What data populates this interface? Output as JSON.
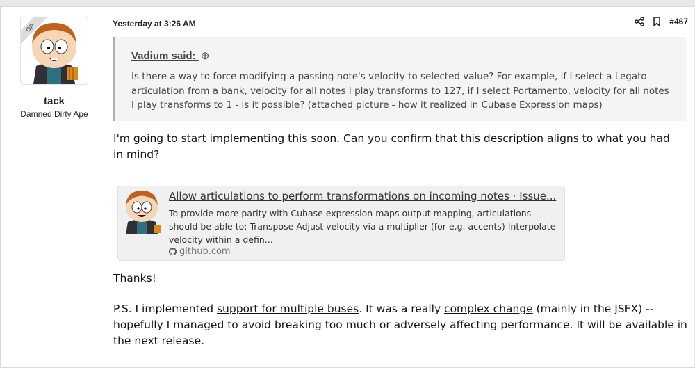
{
  "author": {
    "op_badge": "OP",
    "name": "tack",
    "title": "Damned Dirty Ape"
  },
  "post": {
    "date": "Yesterday at 3:26 AM",
    "number": "#467",
    "quote": {
      "author_line": "Vadium said:",
      "arrow": "⊕",
      "text": "Is there a way to force modifying a passing note's velocity to selected value? For example, if I select a Legato articulation from a bank, velocity for all notes I play transforms to 127, if I select Portamento, velocity for all notes I play transforms to 1 - is it possible? (attached picture - how it realized in Cubase Expression maps)"
    },
    "paragraph1": "I'm going to start implementing this soon. Can you confirm that this description aligns to what you had in mind?",
    "unfurl": {
      "title": "Allow articulations to perform transformations on incoming notes · Issue...",
      "description": "To provide more parity with Cubase expression maps output mapping, articulations should be able to: Transpose Adjust velocity via a multiplier (for e.g. accents) Interpolate velocity within a defin...",
      "domain": "github.com"
    },
    "paragraph2": "Thanks!",
    "ps": {
      "before": "P.S. I implemented ",
      "link1": "support for multiple buses",
      "middle": ". It was a really ",
      "link2": "complex change",
      "after": " (mainly in the JSFX) -- hopefully I managed to avoid breaking too much or adversely affecting performance. It will be available in the next release."
    }
  },
  "icons": [
    "share-icon",
    "bookmark-icon",
    "arrow-up-circle-icon",
    "github-icon"
  ]
}
